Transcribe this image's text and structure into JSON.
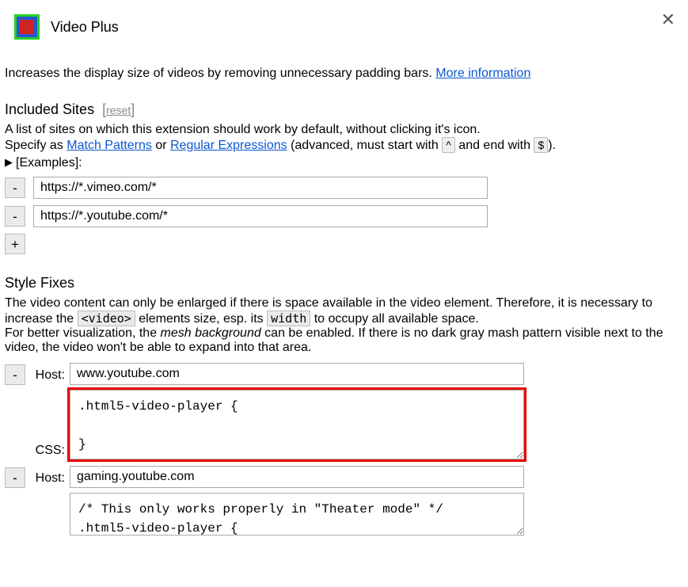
{
  "header": {
    "title": "Video Plus"
  },
  "intro": {
    "text": "Increases the display size of videos by removing unnecessary padding bars. ",
    "more_info": "More information"
  },
  "included": {
    "heading": "Included Sites",
    "reset": "reset",
    "desc1": "A list of sites on which this extension should work by default, without clicking it's icon.",
    "specify_pre": "Specify as ",
    "match_patterns": "Match Patterns",
    "or": " or ",
    "regex": "Regular Expressions",
    "adv_pre": " (advanced, must start with ",
    "caret": "^",
    "adv_mid": " and end with ",
    "dollar": "$",
    "adv_post": ").",
    "examples": "[Examples]:",
    "sites": [
      {
        "url": "https://*.vimeo.com/*"
      },
      {
        "url": "https://*.youtube.com/*"
      }
    ],
    "minus": "-",
    "plus": "+"
  },
  "stylefixes": {
    "heading": "Style Fixes",
    "p1a": "The video content can only be enlarged if there is space available in the video element. Therefore, it is necessary to increase the ",
    "video_tag": "<video>",
    "p1b": " elements size, esp. its ",
    "width_tag": "width",
    "p1c": " to occupy all available space.",
    "p2a": "For better visualization, the ",
    "mesh": "mesh background",
    "p2b": " can be enabled. If there is no dark gray mash pattern visible next to the video, the video won't be able to expand into that area.",
    "host_label": "Host:",
    "css_label": "CSS:",
    "entries": [
      {
        "host": "www.youtube.com",
        "css": ".html5-video-player {\n\n}",
        "highlight": true
      },
      {
        "host": "gaming.youtube.com",
        "css": "/* This only works properly in \"Theater mode\" */\n.html5-video-player {\n",
        "highlight": false
      }
    ]
  }
}
